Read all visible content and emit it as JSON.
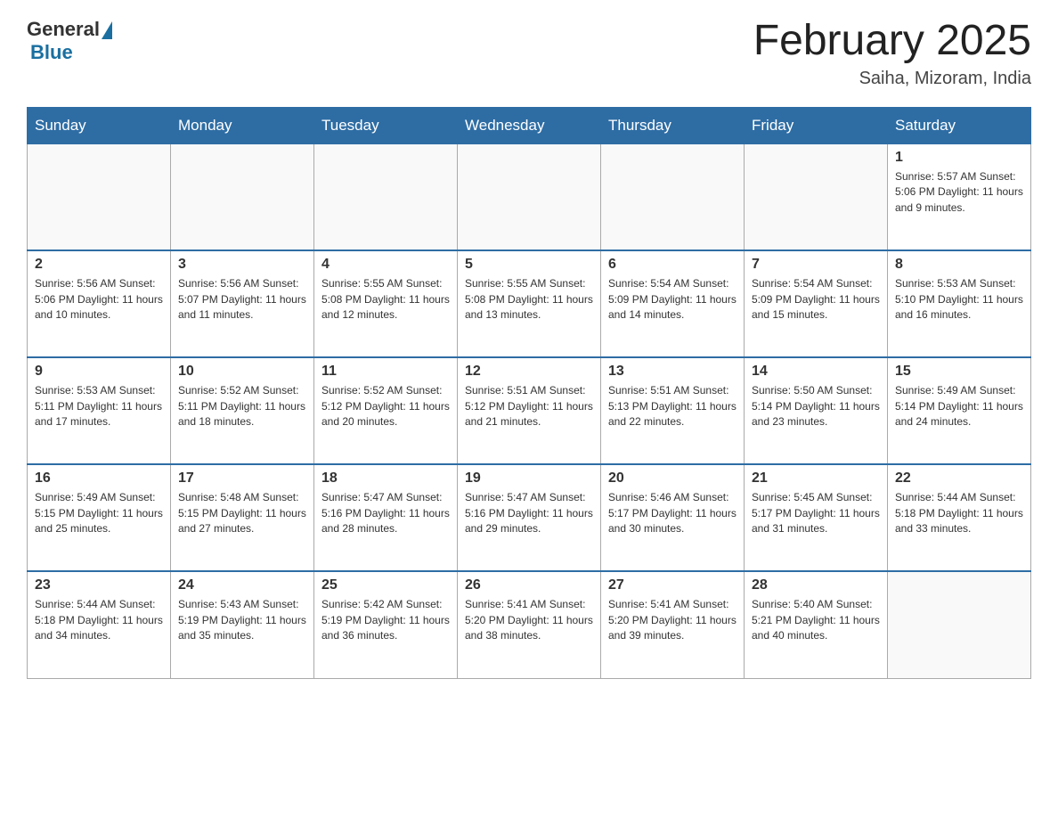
{
  "header": {
    "logo": {
      "general": "General",
      "blue": "Blue"
    },
    "title": "February 2025",
    "location": "Saiha, Mizoram, India"
  },
  "calendar": {
    "days_of_week": [
      "Sunday",
      "Monday",
      "Tuesday",
      "Wednesday",
      "Thursday",
      "Friday",
      "Saturday"
    ],
    "weeks": [
      [
        {
          "day": "",
          "info": ""
        },
        {
          "day": "",
          "info": ""
        },
        {
          "day": "",
          "info": ""
        },
        {
          "day": "",
          "info": ""
        },
        {
          "day": "",
          "info": ""
        },
        {
          "day": "",
          "info": ""
        },
        {
          "day": "1",
          "info": "Sunrise: 5:57 AM\nSunset: 5:06 PM\nDaylight: 11 hours and 9 minutes."
        }
      ],
      [
        {
          "day": "2",
          "info": "Sunrise: 5:56 AM\nSunset: 5:06 PM\nDaylight: 11 hours and 10 minutes."
        },
        {
          "day": "3",
          "info": "Sunrise: 5:56 AM\nSunset: 5:07 PM\nDaylight: 11 hours and 11 minutes."
        },
        {
          "day": "4",
          "info": "Sunrise: 5:55 AM\nSunset: 5:08 PM\nDaylight: 11 hours and 12 minutes."
        },
        {
          "day": "5",
          "info": "Sunrise: 5:55 AM\nSunset: 5:08 PM\nDaylight: 11 hours and 13 minutes."
        },
        {
          "day": "6",
          "info": "Sunrise: 5:54 AM\nSunset: 5:09 PM\nDaylight: 11 hours and 14 minutes."
        },
        {
          "day": "7",
          "info": "Sunrise: 5:54 AM\nSunset: 5:09 PM\nDaylight: 11 hours and 15 minutes."
        },
        {
          "day": "8",
          "info": "Sunrise: 5:53 AM\nSunset: 5:10 PM\nDaylight: 11 hours and 16 minutes."
        }
      ],
      [
        {
          "day": "9",
          "info": "Sunrise: 5:53 AM\nSunset: 5:11 PM\nDaylight: 11 hours and 17 minutes."
        },
        {
          "day": "10",
          "info": "Sunrise: 5:52 AM\nSunset: 5:11 PM\nDaylight: 11 hours and 18 minutes."
        },
        {
          "day": "11",
          "info": "Sunrise: 5:52 AM\nSunset: 5:12 PM\nDaylight: 11 hours and 20 minutes."
        },
        {
          "day": "12",
          "info": "Sunrise: 5:51 AM\nSunset: 5:12 PM\nDaylight: 11 hours and 21 minutes."
        },
        {
          "day": "13",
          "info": "Sunrise: 5:51 AM\nSunset: 5:13 PM\nDaylight: 11 hours and 22 minutes."
        },
        {
          "day": "14",
          "info": "Sunrise: 5:50 AM\nSunset: 5:14 PM\nDaylight: 11 hours and 23 minutes."
        },
        {
          "day": "15",
          "info": "Sunrise: 5:49 AM\nSunset: 5:14 PM\nDaylight: 11 hours and 24 minutes."
        }
      ],
      [
        {
          "day": "16",
          "info": "Sunrise: 5:49 AM\nSunset: 5:15 PM\nDaylight: 11 hours and 25 minutes."
        },
        {
          "day": "17",
          "info": "Sunrise: 5:48 AM\nSunset: 5:15 PM\nDaylight: 11 hours and 27 minutes."
        },
        {
          "day": "18",
          "info": "Sunrise: 5:47 AM\nSunset: 5:16 PM\nDaylight: 11 hours and 28 minutes."
        },
        {
          "day": "19",
          "info": "Sunrise: 5:47 AM\nSunset: 5:16 PM\nDaylight: 11 hours and 29 minutes."
        },
        {
          "day": "20",
          "info": "Sunrise: 5:46 AM\nSunset: 5:17 PM\nDaylight: 11 hours and 30 minutes."
        },
        {
          "day": "21",
          "info": "Sunrise: 5:45 AM\nSunset: 5:17 PM\nDaylight: 11 hours and 31 minutes."
        },
        {
          "day": "22",
          "info": "Sunrise: 5:44 AM\nSunset: 5:18 PM\nDaylight: 11 hours and 33 minutes."
        }
      ],
      [
        {
          "day": "23",
          "info": "Sunrise: 5:44 AM\nSunset: 5:18 PM\nDaylight: 11 hours and 34 minutes."
        },
        {
          "day": "24",
          "info": "Sunrise: 5:43 AM\nSunset: 5:19 PM\nDaylight: 11 hours and 35 minutes."
        },
        {
          "day": "25",
          "info": "Sunrise: 5:42 AM\nSunset: 5:19 PM\nDaylight: 11 hours and 36 minutes."
        },
        {
          "day": "26",
          "info": "Sunrise: 5:41 AM\nSunset: 5:20 PM\nDaylight: 11 hours and 38 minutes."
        },
        {
          "day": "27",
          "info": "Sunrise: 5:41 AM\nSunset: 5:20 PM\nDaylight: 11 hours and 39 minutes."
        },
        {
          "day": "28",
          "info": "Sunrise: 5:40 AM\nSunset: 5:21 PM\nDaylight: 11 hours and 40 minutes."
        },
        {
          "day": "",
          "info": ""
        }
      ]
    ]
  }
}
